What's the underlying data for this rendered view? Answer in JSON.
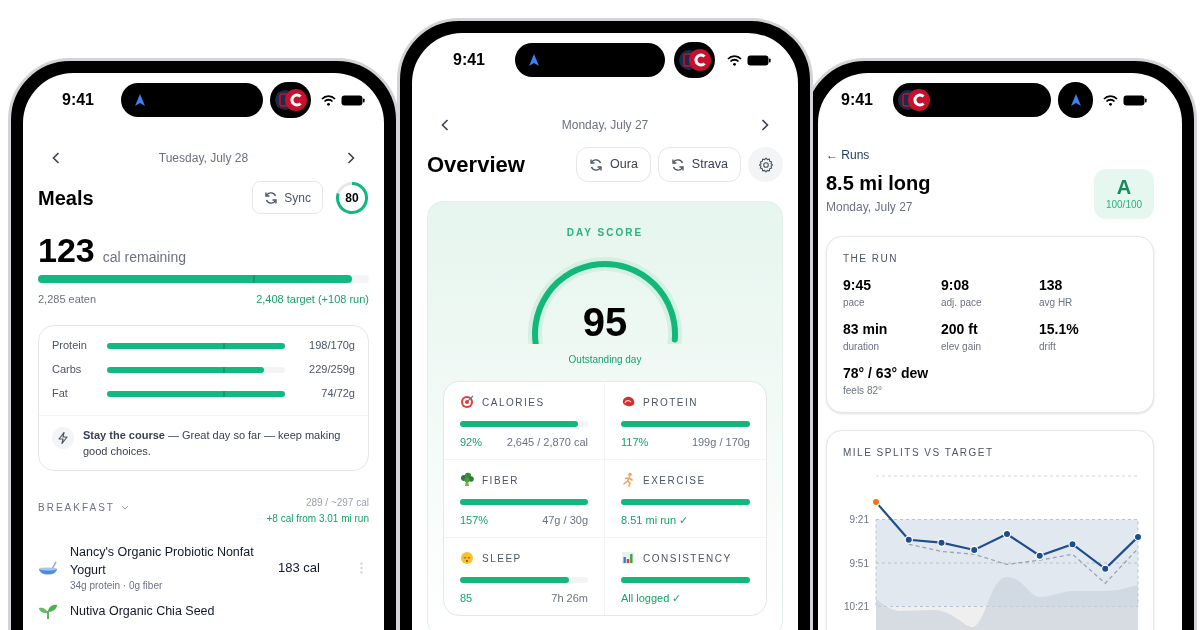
{
  "meals_screen": {
    "status": {
      "time": "9:41",
      "kind": "arrow-in-pill"
    },
    "date": "Tuesday, July 28",
    "title": "Meals",
    "sync_button": "Sync",
    "score": {
      "value": "80",
      "level": 0.8
    },
    "remaining": {
      "value": "123",
      "label": "cal remaining",
      "level": 0.95,
      "eaten": "2,285 eaten",
      "target": "2,408 target (+108 run)"
    },
    "macros": [
      {
        "name": "Protein",
        "level": 1,
        "value": "198/170g"
      },
      {
        "name": "Carbs",
        "level": 0.88,
        "value": "229/259g"
      },
      {
        "name": "Fat",
        "level": 1,
        "value": "74/72g"
      }
    ],
    "tip": "**Stay the course** — Great day so far — keep making good choices.",
    "section": {
      "title": "BREAKFAST",
      "totals": "289 / ~297 cal",
      "bonus": "+8 cal from 3.01 mi run",
      "items": [
        {
          "kind": "bowl",
          "name": "Nancy's Organic Probiotic Nonfat Yogurt",
          "detail": "34g protein · 0g fiber",
          "calories": "183 cal"
        },
        {
          "kind": "sprout",
          "name": "Nutiva Organic Chia Seed"
        }
      ]
    }
  },
  "overview_screen": {
    "status": {
      "time": "9:41",
      "kind": "arrow-in-pill"
    },
    "date": "Monday, July 27",
    "title": "Overview",
    "sync_buttons": [
      "Oura",
      "Strava"
    ],
    "day_score": {
      "label": "DAY SCORE",
      "value": "95",
      "level": 0.95,
      "caption": "Outstanding day"
    },
    "metrics": [
      {
        "kind": "calories",
        "label": "CALORIES",
        "level": 0.92,
        "percent": "92%",
        "detail": "2,645 / 2,870 cal"
      },
      {
        "kind": "protein",
        "label": "PROTEIN",
        "level": 1,
        "percent": "117%",
        "detail": "199g / 170g"
      },
      {
        "kind": "fiber",
        "label": "FIBER",
        "level": 1,
        "percent": "157%",
        "detail": "47g / 30g"
      },
      {
        "kind": "exercise",
        "label": "EXERCISE",
        "level": 1,
        "summary": "8.51 mi run ✓"
      },
      {
        "kind": "sleep",
        "label": "SLEEP",
        "level": 0.85,
        "percent": "85",
        "detail": "7h 26m"
      },
      {
        "kind": "consistency",
        "label": "CONSISTENCY",
        "level": 1,
        "summary": "All logged ✓"
      }
    ]
  },
  "run_screen": {
    "status": {
      "time": "9:41",
      "kind": "logo-in-pill"
    },
    "back_link": "← Runs",
    "title": "8.5 mi long",
    "date": "Monday, July 27",
    "grade": {
      "letter": "A",
      "score": "100/100"
    },
    "run_card": {
      "heading": "THE RUN",
      "stats": [
        {
          "value": "9:45",
          "label": "pace"
        },
        {
          "value": "9:08",
          "label": "adj. pace"
        },
        {
          "value": "138",
          "label": "avg HR"
        },
        {
          "value": "83 min",
          "label": "duration"
        },
        {
          "value": "200 ft",
          "label": "elev gain"
        },
        {
          "value": "15.1%",
          "label": "drift"
        }
      ],
      "weather": {
        "value": "78° / 63° dew",
        "label": "feels 82°"
      }
    },
    "splits_card": {
      "heading": "MILE SPLITS VS TARGET",
      "chart_data": {
        "type": "line",
        "categories": [
          null,
          null,
          null,
          null,
          null,
          null,
          null,
          null,
          null
        ],
        "ylim": [
          621,
          531
        ],
        "yticks": [
          {
            "value": 561,
            "label": "9:21"
          },
          {
            "value": 591,
            "label": "9:51"
          },
          {
            "value": 621,
            "label": "10:21"
          }
        ],
        "series": [
          {
            "color": "#9ca3af",
            "line_style": "dashed",
            "marker": false,
            "values": [
              null,
              578,
              583,
              585,
              592,
              589,
              585,
              605,
              581
            ]
          },
          {
            "color": "#1e4d8c",
            "marker": true,
            "values": [
              549,
              575,
              577,
              582,
              571,
              586,
              578,
              595,
              573
            ]
          },
          {
            "color": "#f97316",
            "marker": true,
            "values": [
              549,
              null,
              null,
              null,
              null,
              null,
              null,
              null,
              null
            ]
          }
        ]
      }
    }
  }
}
